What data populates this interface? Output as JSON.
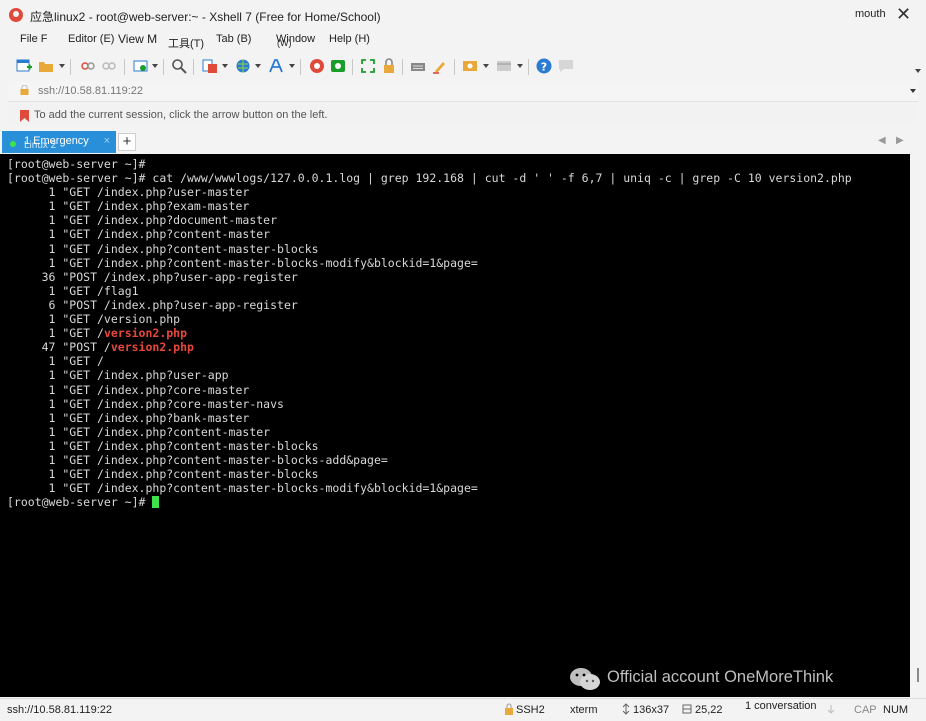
{
  "window": {
    "title": "应急linux2 - root@web-server:~ - Xshell 7 (Free for Home/School)",
    "user": "mouth",
    "close_symbol": "✕"
  },
  "menu": {
    "items": [
      "File F",
      "Editor (E)",
      "View M",
      "工具(T)",
      "Tab (B)",
      "(W)",
      "Window",
      "Help (H)"
    ]
  },
  "address": {
    "text": "ssh://10.58.81.119:22"
  },
  "info": {
    "message": "To add the current session, click the arrow button on the left."
  },
  "tabs": [
    {
      "label": "1 Emergency",
      "sublabel": "Linux 2",
      "close": "×"
    }
  ],
  "tabstrip": {
    "add": "+",
    "prev": "◀",
    "next": "▶"
  },
  "terminal": {
    "lines": [
      {
        "text": "[root@web-server ~]#"
      },
      {
        "text": "[root@web-server ~]# cat /www/wwwlogs/127.0.0.1.log | grep 192.168 | cut -d ' ' -f 6,7 | uniq -c | grep -C 10 version2.php"
      },
      {
        "text": "      1 \"GET /index.php?user-master"
      },
      {
        "text": "      1 \"GET /index.php?exam-master"
      },
      {
        "text": "      1 \"GET /index.php?document-master"
      },
      {
        "text": "      1 \"GET /index.php?content-master"
      },
      {
        "text": "      1 \"GET /index.php?content-master-blocks"
      },
      {
        "text": "      1 \"GET /index.php?content-master-blocks-modify&blockid=1&page="
      },
      {
        "text": "     36 \"POST /index.php?user-app-register"
      },
      {
        "text": "      1 \"GET /flag1"
      },
      {
        "text": "      6 \"POST /index.php?user-app-register"
      },
      {
        "text": "      1 \"GET /version.php"
      },
      {
        "text": "      1 \"GET /",
        "highlight": "version2.php"
      },
      {
        "text": "     47 \"POST /",
        "highlight": "version2.php"
      },
      {
        "text": "      1 \"GET /"
      },
      {
        "text": "      1 \"GET /index.php?user-app"
      },
      {
        "text": "      1 \"GET /index.php?core-master"
      },
      {
        "text": "      1 \"GET /index.php?core-master-navs"
      },
      {
        "text": "      1 \"GET /index.php?bank-master"
      },
      {
        "text": "      1 \"GET /index.php?content-master"
      },
      {
        "text": "      1 \"GET /index.php?content-master-blocks"
      },
      {
        "text": "      1 \"GET /index.php?content-master-blocks-add&page="
      },
      {
        "text": "      1 \"GET /index.php?content-master-blocks"
      },
      {
        "text": "      1 \"GET /index.php?content-master-blocks-modify&blockid=1&page="
      },
      {
        "text": "[root@web-server ~]# ",
        "cursor": true
      }
    ]
  },
  "watermark": {
    "text": "Official account OneMoreThink"
  },
  "status": {
    "address": "ssh://10.58.81.119:22",
    "protocol": "SSH2",
    "terminal_type": "xterm",
    "size": "136x37",
    "cursor_pos": "25,22",
    "sessions": "1 conversation",
    "caps": "CAP",
    "num": "NUM"
  },
  "colors": {
    "tab_active": "#2a8fd9",
    "terminal_bg": "#000000",
    "terminal_fg": "#d8d8d8",
    "highlight": "#e8473c",
    "cursor": "#3ee24a"
  }
}
